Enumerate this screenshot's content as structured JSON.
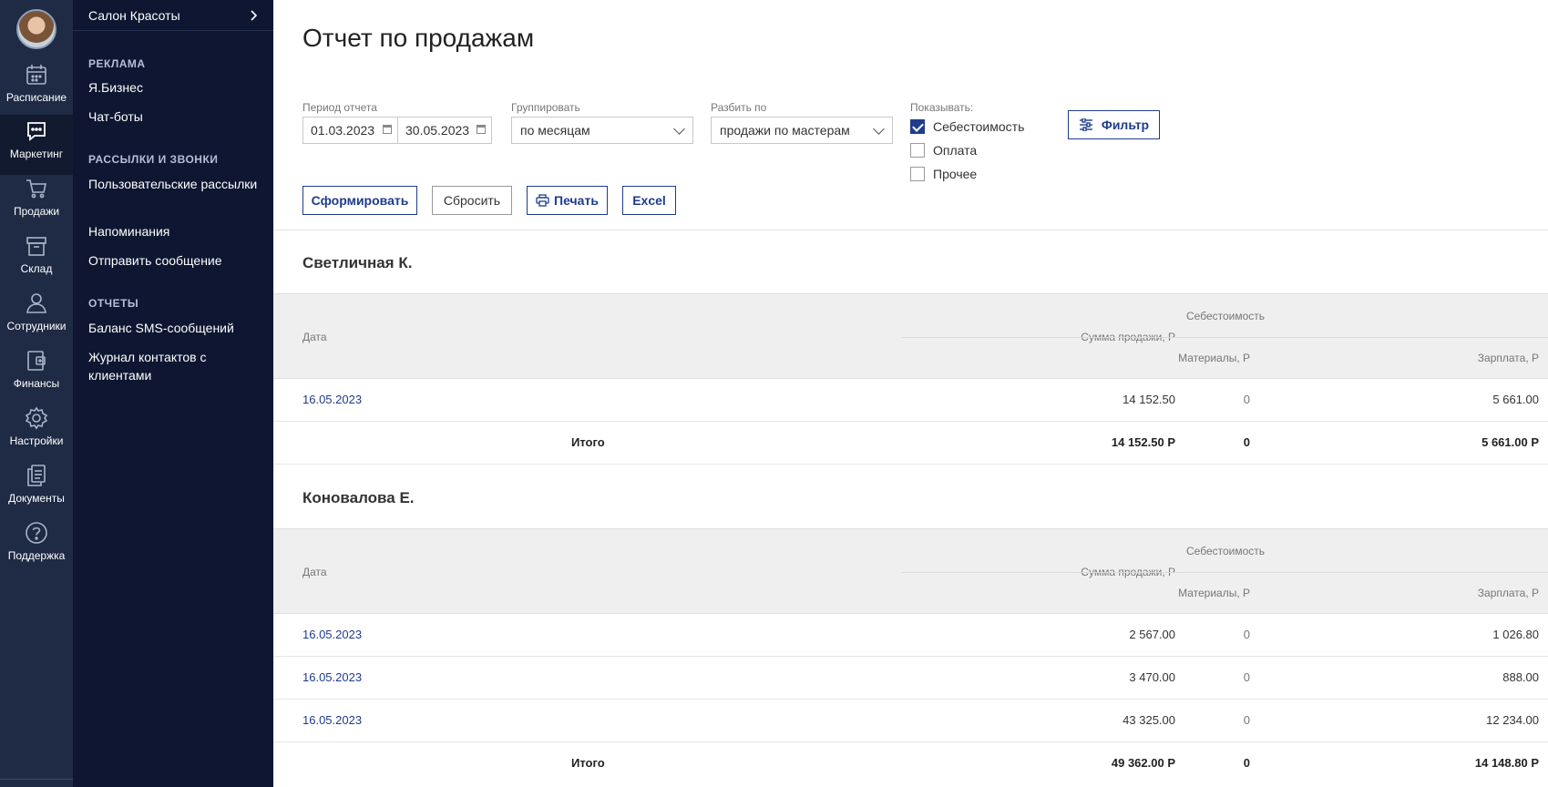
{
  "rail": {
    "items": [
      {
        "label": "Расписание",
        "icon": "calendar-icon"
      },
      {
        "label": "Маркетинг",
        "icon": "chat-icon",
        "active": true
      },
      {
        "label": "Продажи",
        "icon": "cart-icon"
      },
      {
        "label": "Склад",
        "icon": "box-icon"
      },
      {
        "label": "Сотрудники",
        "icon": "person-icon"
      },
      {
        "label": "Финансы",
        "icon": "wallet-icon"
      },
      {
        "label": "Настройки",
        "icon": "gear-icon"
      },
      {
        "label": "Документы",
        "icon": "documents-icon"
      },
      {
        "label": "Поддержка",
        "icon": "help-icon"
      }
    ]
  },
  "submenu": {
    "salon": "Салон Красоты",
    "sections": [
      {
        "title": "РЕКЛАМА",
        "items": [
          "Я.Бизнес",
          "Чат-боты"
        ]
      },
      {
        "title": "РАССЫЛКИ И ЗВОНКИ",
        "items": [
          "Пользовательские рассылки",
          "Напоминания",
          "Отправить сообщение"
        ]
      },
      {
        "title": "ОТЧЕТЫ",
        "items": [
          "Баланс SMS-сообщений",
          "Журнал контактов с клиентами"
        ]
      }
    ]
  },
  "page": {
    "title": "Отчет по продажам",
    "filters": {
      "period_label": "Период отчета",
      "date_from": "01.03.2023",
      "date_to": "30.05.2023",
      "group_label": "Группировать",
      "group_value": "по месяцам",
      "split_label": "Разбить по",
      "split_value": "продажи по мастерам",
      "show_label": "Показывать:",
      "show_options": [
        {
          "label": "Себестоимость",
          "checked": true
        },
        {
          "label": "Оплата",
          "checked": false
        },
        {
          "label": "Прочее",
          "checked": false
        }
      ],
      "filter_button": "Фильтр"
    },
    "actions": {
      "generate": "Сформировать",
      "reset": "Сбросить",
      "print": "Печать",
      "excel": "Excel"
    },
    "table_headers": {
      "date": "Дата",
      "sum": "Сумма продажи, Р",
      "cost": "Себестоимость",
      "materials": "Материалы, Р",
      "salary": "Зарплата, Р"
    },
    "total_label": "Итого",
    "groups": [
      {
        "name": "Светличная К.",
        "rows": [
          {
            "date": "16.05.2023",
            "sum": "14 152.50",
            "materials": "0",
            "salary": "5 661.00"
          }
        ],
        "total": {
          "sum": "14 152.50 Р",
          "materials": "0",
          "salary": "5 661.00 Р"
        }
      },
      {
        "name": "Коновалова Е.",
        "rows": [
          {
            "date": "16.05.2023",
            "sum": "2 567.00",
            "materials": "0",
            "salary": "1 026.80"
          },
          {
            "date": "16.05.2023",
            "sum": "3 470.00",
            "materials": "0",
            "salary": "888.00"
          },
          {
            "date": "16.05.2023",
            "sum": "43 325.00",
            "materials": "0",
            "salary": "12 234.00"
          }
        ],
        "total": {
          "sum": "49 362.00 Р",
          "materials": "0",
          "salary": "14 148.80 Р"
        }
      }
    ]
  }
}
